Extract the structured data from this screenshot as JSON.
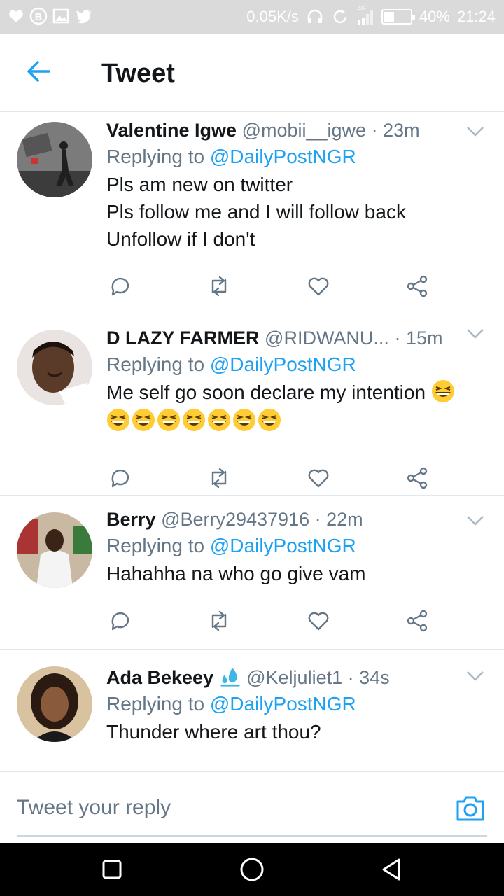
{
  "status_bar": {
    "net_speed": "0.05K/s",
    "network_type": "4G",
    "battery_level": "40%",
    "battery_fraction": 0.4,
    "time": "21:24"
  },
  "header": {
    "title": "Tweet",
    "back_icon": "arrow-left-icon"
  },
  "colors": {
    "accent": "#1da1f2",
    "secondary_text": "#657786",
    "divider": "#e1e8ed"
  },
  "tweets": [
    {
      "name": "Valentine Igwe",
      "handle": "@mobii__igwe",
      "time": "· 23m",
      "replying_label": "Replying to",
      "replying_to": "@DailyPostNGR",
      "lines": [
        "Pls am new on twitter",
        "Pls follow me and I will follow back",
        "Unfollow if I don't"
      ]
    },
    {
      "name": "D LAZY FARMER",
      "handle": "@RIDWANU...",
      "time": "· 15m",
      "replying_label": "Replying to",
      "replying_to": "@DailyPostNGR",
      "lines": [
        "Me self go soon declare my intention"
      ],
      "emoji": "grinning-squinting-face",
      "emoji_count": 8
    },
    {
      "name": "Berry",
      "handle": "@Berry29437916",
      "time": "· 22m",
      "replying_label": "Replying to",
      "replying_to": "@DailyPostNGR",
      "lines": [
        "Hahahha na who go give vam"
      ]
    },
    {
      "name": "Ada Bekeey",
      "name_emoji": "droplet-icon",
      "handle": "@Keljuliet1",
      "time": "· 34s",
      "replying_label": "Replying to",
      "replying_to": "@DailyPostNGR",
      "lines": [
        "Thunder where art thou?"
      ]
    }
  ],
  "actions": [
    "reply-icon",
    "retweet-icon",
    "like-icon",
    "share-icon"
  ],
  "reply_bar": {
    "placeholder": "Tweet your reply",
    "camera_icon": "camera-icon"
  },
  "nav": [
    "recents-button",
    "home-button",
    "back-button"
  ]
}
